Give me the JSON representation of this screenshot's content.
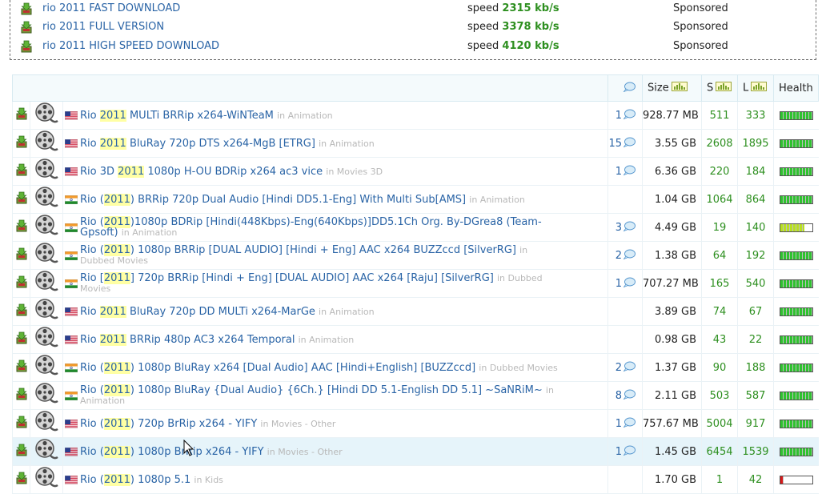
{
  "sponsored": [
    {
      "title": "rio 2011 FAST DOWNLOAD",
      "speed_label": "speed",
      "speed": "2315 kb/s",
      "tag": "Sponsored"
    },
    {
      "title": "rio 2011 FULL VERSION",
      "speed_label": "speed",
      "speed": "3378 kb/s",
      "tag": "Sponsored"
    },
    {
      "title": "rio 2011 HIGH SPEED DOWNLOAD",
      "speed_label": "speed",
      "speed": "4120 kb/s",
      "tag": "Sponsored"
    }
  ],
  "header": {
    "size": "Size",
    "seeders": "S",
    "leechers": "L",
    "health": "Health"
  },
  "colors": {
    "link": "#2a64a6",
    "green": "#2d8f1f",
    "health_full": "#2fc22f",
    "health_mid": "#b8e020",
    "health_low": "#d81818"
  },
  "rows": [
    {
      "flag": "us",
      "pre": "Rio ",
      "year": "2011",
      "post": " MULTi BRRip x264-WiNTeaM",
      "cat": "in Animation",
      "comments": "1",
      "size": "928.77 MB",
      "s": "511",
      "l": "333",
      "health": 1.0
    },
    {
      "flag": "us",
      "pre": "Rio ",
      "year": "2011",
      "post": " BluRay 720p DTS x264-MgB [ETRG]",
      "cat": "in Animation",
      "comments": "15",
      "size": "3.55 GB",
      "s": "2608",
      "l": "1895",
      "health": 1.0
    },
    {
      "flag": "us",
      "pre": "Rio 3D ",
      "year": "2011",
      "post": " 1080p H-OU BDRip x264 ac3 vice",
      "cat": "in Movies 3D",
      "comments": "1",
      "size": "6.36 GB",
      "s": "220",
      "l": "184",
      "health": 1.0
    },
    {
      "flag": "in",
      "pre": "Rio (",
      "year": "2011",
      "post": ") BRRip 720p Dual Audio [Hindi DD5.1-Eng] With Multi Sub[AMS]",
      "cat": "in Animation",
      "comments": "",
      "size": "1.04 GB",
      "s": "1064",
      "l": "864",
      "health": 1.0
    },
    {
      "flag": "in",
      "pre": "Rio (",
      "year": "2011",
      "post": ")1080p BDRip [Hindi(448Kbps)-Eng(640Kbps)]DD5.1Ch Org. By-DGrea8 (Team-Gpsoft)",
      "cat": "in Animation",
      "comments": "3",
      "size": "4.49 GB",
      "s": "19",
      "l": "140",
      "health": 0.75
    },
    {
      "flag": "in",
      "pre": "Rio (",
      "year": "2011",
      "post": ") 1080p BRRip [DUAL AUDIO] [Hindi + Eng] AAC x264 BUZZccd [SilverRG]",
      "cat": "in Dubbed Movies",
      "comments": "2",
      "size": "1.38 GB",
      "s": "64",
      "l": "192",
      "health": 1.0
    },
    {
      "flag": "in",
      "pre": "Rio [",
      "year": "2011",
      "post": "] 720p BRRip [Hindi + Eng] [DUAL AUDIO] AAC x264 [Raju] [SilverRG]",
      "cat": "in Dubbed Movies",
      "comments": "1",
      "size": "707.27 MB",
      "s": "165",
      "l": "540",
      "health": 1.0
    },
    {
      "flag": "us",
      "pre": "Rio ",
      "year": "2011",
      "post": " BluRay 720p DD MULTi x264-MarGe",
      "cat": "in Animation",
      "comments": "",
      "size": "3.89 GB",
      "s": "74",
      "l": "67",
      "health": 1.0
    },
    {
      "flag": "us",
      "pre": "Rio ",
      "year": "2011",
      "post": " BRRip 480p AC3 x264 Temporal",
      "cat": "in Animation",
      "comments": "",
      "size": "0.98 GB",
      "s": "43",
      "l": "22",
      "health": 1.0
    },
    {
      "flag": "in",
      "pre": "Rio (",
      "year": "2011",
      "post": ") 1080p BluRay x264 [Dual Audio] AAC [Hindi+English] [BUZZccd]",
      "cat": "in Dubbed Movies",
      "comments": "2",
      "size": "1.37 GB",
      "s": "90",
      "l": "188",
      "health": 1.0
    },
    {
      "flag": "in",
      "pre": "Rio (",
      "year": "2011",
      "post": ") 1080p BluRay {Dual Audio} {6Ch.} [Hindi DD 5.1-English DD 5.1] ~SaNRiM~",
      "cat": "in Animation",
      "comments": "8",
      "size": "2.11 GB",
      "s": "503",
      "l": "587",
      "health": 1.0
    },
    {
      "flag": "us",
      "pre": "Rio (",
      "year": "2011",
      "post": ") 720p BrRip x264 - YIFY",
      "cat": "in Movies - Other",
      "comments": "1",
      "size": "757.67 MB",
      "s": "5004",
      "l": "917",
      "health": 1.0
    },
    {
      "flag": "us",
      "pre": "Rio (",
      "year": "2011",
      "post": ") 1080p BrRip x264 - YIFY",
      "cat": "in Movies - Other",
      "comments": "1",
      "size": "1.45 GB",
      "s": "6454",
      "l": "1539",
      "health": 1.0
    },
    {
      "flag": "us",
      "pre": "Rio (",
      "year": "2011",
      "post": ") 1080p 5.1",
      "cat": "in Kids",
      "comments": "",
      "size": "1.70 GB",
      "s": "1",
      "l": "42",
      "health": 0.1
    }
  ]
}
